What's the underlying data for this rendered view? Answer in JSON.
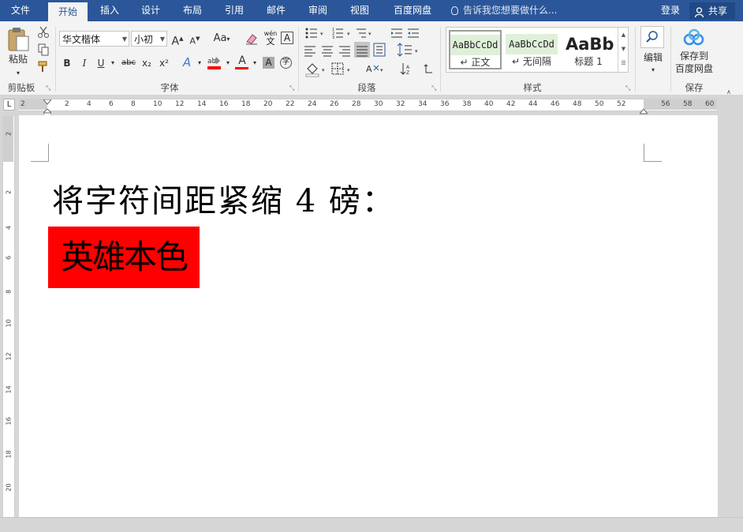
{
  "tabs": {
    "file": "文件",
    "home": "开始",
    "insert": "插入",
    "design": "设计",
    "layout": "布局",
    "references": "引用",
    "mailings": "邮件",
    "review": "审阅",
    "view": "视图",
    "baidu": "百度网盘"
  },
  "tell_me": "告诉我您想要做什么...",
  "login": "登录",
  "share": "共享",
  "clipboard": {
    "paste": "粘贴",
    "group": "剪贴板"
  },
  "font": {
    "family": "华文楷体",
    "size": "小初",
    "group": "字体",
    "bold": "B",
    "italic": "I",
    "underline": "U",
    "strike": "abc",
    "sub": "x₂",
    "sup": "x²",
    "grow": "A",
    "shrink": "A",
    "case": "Aa",
    "phonetic": "wén",
    "phonetic_sub": "文",
    "border_char": "A",
    "text_effect": "A",
    "font_color": "A",
    "shade": "A",
    "enclose": "字"
  },
  "paragraph": {
    "group": "段落"
  },
  "styles": {
    "group": "样式",
    "items": [
      {
        "sample": "AaBbCcDd",
        "name": "正文"
      },
      {
        "sample": "AaBbCcDd",
        "name": "无间隔"
      },
      {
        "sample": "AaBb",
        "name": "标题 1"
      }
    ]
  },
  "editing": {
    "label": "编辑"
  },
  "save": {
    "line1": "保存到",
    "line2": "百度网盘",
    "group": "保存"
  },
  "ruler": {
    "h_ticks": [
      "2",
      "2",
      "4",
      "6",
      "8",
      "10",
      "12",
      "14",
      "16",
      "18",
      "20",
      "22",
      "24",
      "26",
      "28",
      "30",
      "32",
      "34",
      "36",
      "38",
      "40",
      "42",
      "44",
      "46",
      "48",
      "50",
      "52",
      "56",
      "58",
      "60"
    ],
    "v_ticks": [
      "2",
      "2",
      "4",
      "6",
      "8",
      "10",
      "12",
      "14",
      "16",
      "18",
      "20"
    ]
  },
  "document": {
    "line1": "将字符间距紧缩 4 磅：",
    "line2": "英雄本色",
    "highlight_color": "#ff0000"
  },
  "colors": {
    "accent": "#2b579a",
    "underline_red": "#ff0000"
  }
}
